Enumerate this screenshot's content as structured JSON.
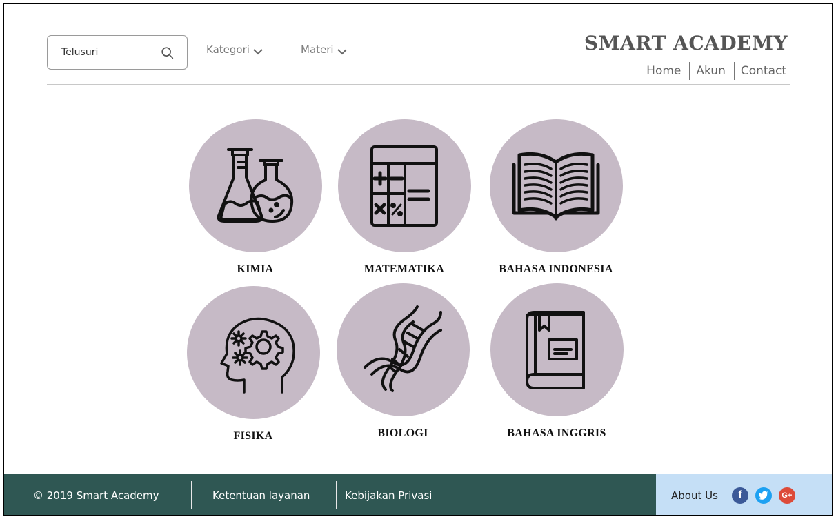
{
  "header": {
    "search": {
      "placeholder": "Telusuri"
    },
    "menus": [
      {
        "label": "Kategori"
      },
      {
        "label": "Materi"
      }
    ],
    "brand": "SMART ACADEMY",
    "links": [
      "Home",
      "Akun",
      "Contact"
    ]
  },
  "subjects": [
    {
      "label": "KIMIA",
      "icon": "flask-icon"
    },
    {
      "label": "MATEMATIKA",
      "icon": "calculator-icon"
    },
    {
      "label": "BAHASA INDONESIA",
      "icon": "open-book-icon"
    },
    {
      "label": "FISIKA",
      "icon": "brain-gears-icon"
    },
    {
      "label": "BIOLOGI",
      "icon": "dna-icon"
    },
    {
      "label": "BAHASA INGGRIS",
      "icon": "closed-book-icon"
    }
  ],
  "footer": {
    "copyright": "© 2019 Smart Academy",
    "terms": "Ketentuan layanan",
    "privacy": "Kebijakan Privasi",
    "about": "About Us",
    "social": [
      {
        "icon": "facebook-icon",
        "glyph": "f"
      },
      {
        "icon": "twitter-icon",
        "glyph": "t"
      },
      {
        "icon": "google-plus-icon",
        "glyph": "G+"
      }
    ]
  },
  "colors": {
    "circle": "#c6bac6",
    "footer_dark": "#2f5753",
    "footer_light": "#c5dff6"
  }
}
